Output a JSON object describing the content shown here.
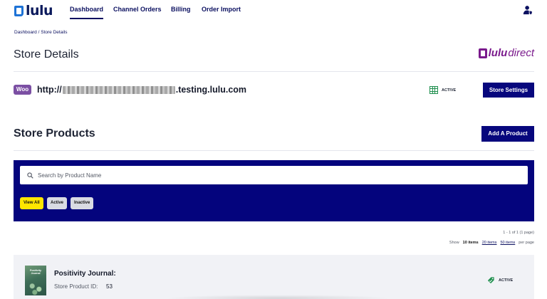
{
  "nav": {
    "logo_text": "lulu",
    "links": [
      "Dashboard",
      "Channel Orders",
      "Billing",
      "Order Import"
    ],
    "active_link": "Dashboard"
  },
  "breadcrumb": {
    "items": [
      "Dashboard",
      "Store Details"
    ],
    "separator": "/"
  },
  "page": {
    "title": "Store Details",
    "brand_lulu": "lulu",
    "brand_direct": "direct"
  },
  "store": {
    "platform_badge": "Woo",
    "url_prefix": "http://",
    "url_suffix": ".testing.lulu.com",
    "status": "ACTIVE",
    "settings_label": "Store Settings"
  },
  "products": {
    "title": "Store Products",
    "add_label": "Add A Product",
    "search_placeholder": "Search by Product Name",
    "filters": [
      "View All",
      "Active",
      "Inactive"
    ],
    "selected_filter": "View All"
  },
  "pagination": {
    "summary": "1 - 1 of 1 (1 page)",
    "show_label": "Show",
    "current_size": "10 items",
    "options": [
      "20 items",
      "50 items"
    ],
    "per_page_label": "per page"
  },
  "product_list": [
    {
      "cover_title": "Positivity Journal",
      "name": "Positivity Journal:",
      "id_label": "Store Product ID:",
      "id": "53",
      "status": "ACTIVE"
    }
  ],
  "colors": {
    "brand_navy": "#07077d",
    "accent_yellow": "#ffe600",
    "lulu_direct_purple": "#7a1a8c",
    "woo_purple": "#7b4fa3",
    "status_green": "#1f8f4e"
  },
  "icons": {
    "account": "user-shield-icon",
    "search": "search-icon",
    "store_status": "grid-status-icon",
    "product_status": "tag-icon"
  }
}
